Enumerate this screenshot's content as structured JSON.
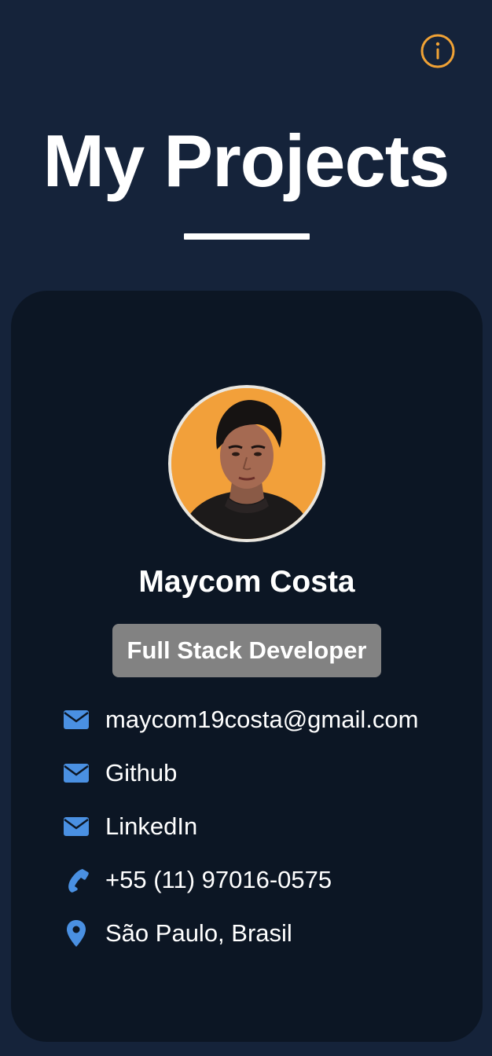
{
  "header": {
    "title": "My Projects",
    "info_icon": "info-circle-icon",
    "info_color": "#f0a235"
  },
  "profile": {
    "name": "Maycom Costa",
    "role": "Full Stack Developer",
    "avatar_alt": "Profile photo"
  },
  "contacts": [
    {
      "icon": "envelope-icon",
      "label": "maycom19costa@gmail.com"
    },
    {
      "icon": "envelope-icon",
      "label": "Github"
    },
    {
      "icon": "envelope-icon",
      "label": "LinkedIn"
    },
    {
      "icon": "phone-icon",
      "label": "+55 (11) 97016-0575"
    },
    {
      "icon": "map-pin-icon",
      "label": "São Paulo, Brasil"
    }
  ],
  "colors": {
    "page_background": "#15233a",
    "card_background": "#0c1624",
    "icon_accent": "#4a90e2",
    "badge_background": "#828282",
    "avatar_background": "#f2a03a"
  }
}
